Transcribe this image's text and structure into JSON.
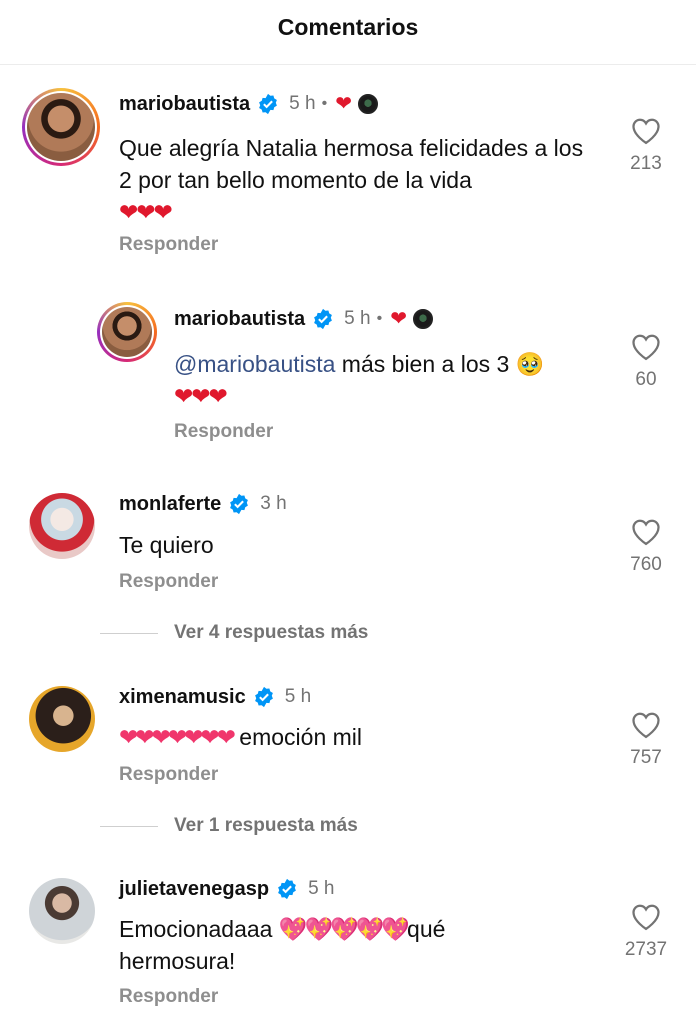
{
  "header": {
    "title": "Comentarios"
  },
  "comments": [
    {
      "username": "mariobautista",
      "time": "5 h",
      "dot": "•",
      "text": "Que alegría Natalia hermosa felicidades a los 2 por tan bello momento de la vida",
      "hearts": "❤❤❤",
      "reply_label": "Responder",
      "likes": "213"
    },
    {
      "username": "mariobautista",
      "time": "5 h",
      "dot": "•",
      "mention": "@mariobautista",
      "text": " más bien a los 3 🥹",
      "hearts": "❤❤❤",
      "reply_label": "Responder",
      "likes": "60"
    },
    {
      "username": "monlaferte",
      "time": "3 h",
      "text": "Te quiero",
      "reply_label": "Responder",
      "likes": "760",
      "more_replies": "Ver 4 respuestas más"
    },
    {
      "username": "ximenamusic",
      "time": "5 h",
      "hearts": "❤❤❤❤❤❤❤",
      "text": " emoción mil",
      "reply_label": "Responder",
      "likes": "757",
      "more_replies": "Ver 1 respuesta más"
    },
    {
      "username": "julietavenegasp",
      "time": "5 h",
      "text_before": "Emocionadaaa ",
      "hearts": "💖💖💖💖💖",
      "text_after": "qué hermosura!",
      "reply_label": "Responder",
      "likes": "2737"
    }
  ],
  "icons": {
    "verified": "verified-badge-icon",
    "like": "heart-outline-icon"
  },
  "colors": {
    "verified": "#0095f6",
    "heart": "#e0182d",
    "muted": "#737373"
  }
}
